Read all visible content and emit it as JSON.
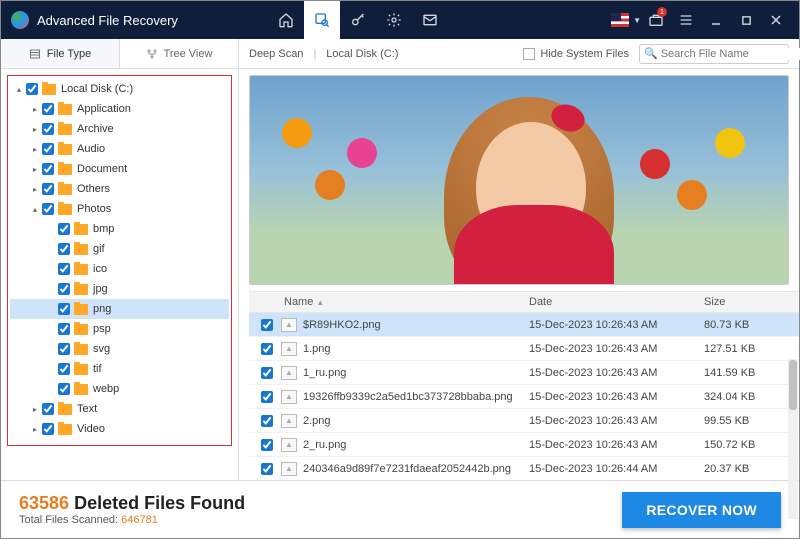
{
  "app": {
    "title": "Advanced File Recovery"
  },
  "titlebar": {
    "toolbox_badge": "1"
  },
  "tabs": {
    "file_type": "File Type",
    "tree_view": "Tree View",
    "deep_scan": "Deep Scan",
    "location": "Local Disk (C:)",
    "hide_system": "Hide System Files",
    "search_placeholder": "Search File Name"
  },
  "tree": {
    "root": "Local Disk (C:)",
    "nodes": [
      {
        "label": "Application",
        "level": 1,
        "expand": "▸"
      },
      {
        "label": "Archive",
        "level": 1,
        "expand": "▸"
      },
      {
        "label": "Audio",
        "level": 1,
        "expand": "▸"
      },
      {
        "label": "Document",
        "level": 1,
        "expand": "▸"
      },
      {
        "label": "Others",
        "level": 1,
        "expand": "▸"
      },
      {
        "label": "Photos",
        "level": 1,
        "expand": "▴"
      },
      {
        "label": "bmp",
        "level": 2,
        "expand": ""
      },
      {
        "label": "gif",
        "level": 2,
        "expand": ""
      },
      {
        "label": "ico",
        "level": 2,
        "expand": ""
      },
      {
        "label": "jpg",
        "level": 2,
        "expand": ""
      },
      {
        "label": "png",
        "level": 2,
        "expand": "",
        "sel": true
      },
      {
        "label": "psp",
        "level": 2,
        "expand": ""
      },
      {
        "label": "svg",
        "level": 2,
        "expand": ""
      },
      {
        "label": "tif",
        "level": 2,
        "expand": ""
      },
      {
        "label": "webp",
        "level": 2,
        "expand": ""
      },
      {
        "label": "Text",
        "level": 1,
        "expand": "▸"
      },
      {
        "label": "Video",
        "level": 1,
        "expand": "▸"
      }
    ]
  },
  "table": {
    "headers": {
      "name": "Name",
      "date": "Date",
      "size": "Size"
    },
    "rows": [
      {
        "name": "$R89HKO2.png",
        "date": "15-Dec-2023 10:26:43 AM",
        "size": "80.73 KB",
        "sel": true
      },
      {
        "name": "1.png",
        "date": "15-Dec-2023 10:26:43 AM",
        "size": "127.51 KB"
      },
      {
        "name": "1_ru.png",
        "date": "15-Dec-2023 10:26:43 AM",
        "size": "141.59 KB"
      },
      {
        "name": "19326ffb9339c2a5ed1bc373728bbaba.png",
        "date": "15-Dec-2023 10:26:43 AM",
        "size": "324.04 KB"
      },
      {
        "name": "2.png",
        "date": "15-Dec-2023 10:26:43 AM",
        "size": "99.55 KB"
      },
      {
        "name": "2_ru.png",
        "date": "15-Dec-2023 10:26:43 AM",
        "size": "150.72 KB"
      },
      {
        "name": "240346a9d89f7e7231fdaeaf2052442b.png",
        "date": "15-Dec-2023 10:26:44 AM",
        "size": "20.37 KB"
      }
    ]
  },
  "footer": {
    "count": "63586",
    "found_label": " Deleted Files Found",
    "scanned_label": "Total Files Scanned: ",
    "scanned": "646781",
    "recover": "RECOVER NOW"
  }
}
